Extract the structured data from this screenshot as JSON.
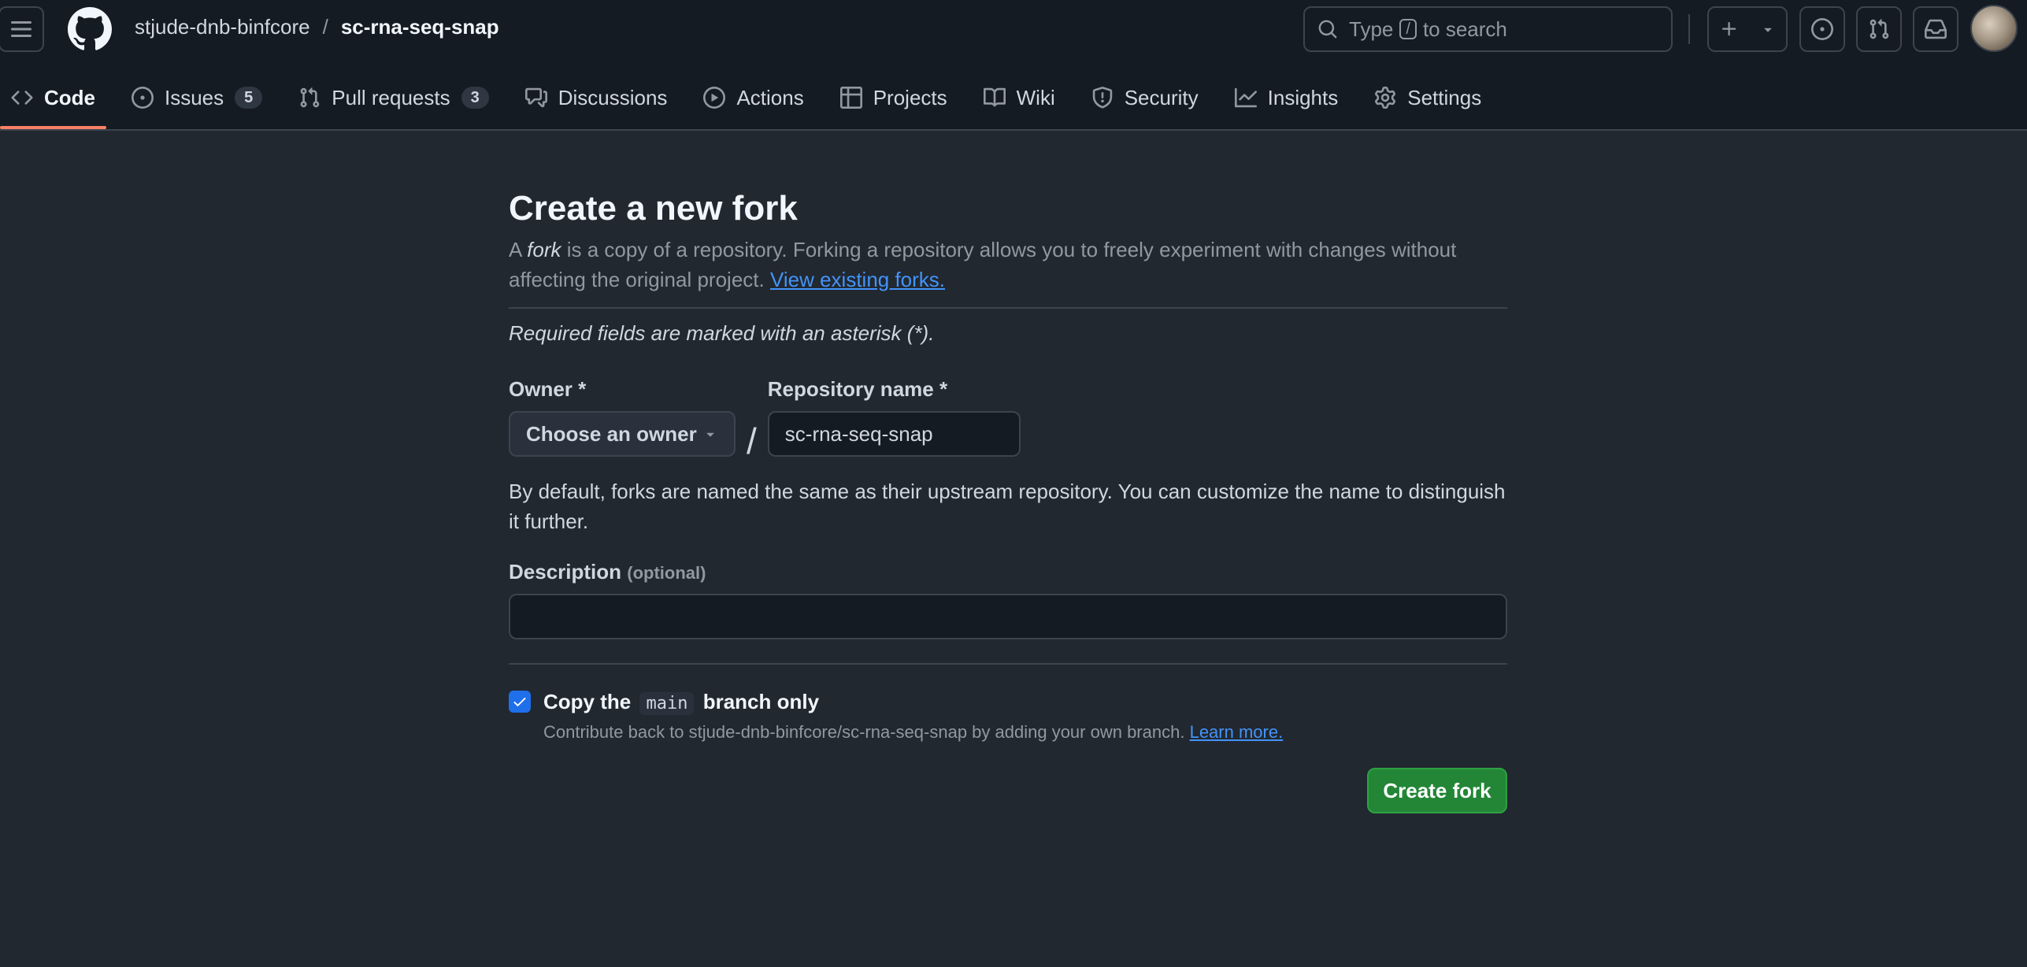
{
  "header": {
    "owner": "stjude-dnb-binfcore",
    "separator": "/",
    "repo": "sc-rna-seq-snap",
    "search": {
      "prefix": "Type",
      "key": "/",
      "suffix": "to search"
    }
  },
  "tabs": [
    {
      "label": "Code",
      "icon": "code-icon",
      "active": true
    },
    {
      "label": "Issues",
      "icon": "issue-opened-icon",
      "count": "5"
    },
    {
      "label": "Pull requests",
      "icon": "git-pull-request-icon",
      "count": "3"
    },
    {
      "label": "Discussions",
      "icon": "comment-discussion-icon"
    },
    {
      "label": "Actions",
      "icon": "play-icon"
    },
    {
      "label": "Projects",
      "icon": "table-icon"
    },
    {
      "label": "Wiki",
      "icon": "book-icon"
    },
    {
      "label": "Security",
      "icon": "shield-icon"
    },
    {
      "label": "Insights",
      "icon": "graph-icon"
    },
    {
      "label": "Settings",
      "icon": "gear-icon"
    }
  ],
  "form": {
    "title": "Create a new fork",
    "lead_a": "A",
    "lead_fork": "fork",
    "lead_b": "is a copy of a repository. Forking a repository allows you to freely experiment with changes without affecting the original project.",
    "view_forks": "View existing forks.",
    "required_note": "Required fields are marked with an asterisk (*).",
    "owner_label": "Owner *",
    "owner_value": "Choose an owner",
    "slash": "/",
    "repo_label": "Repository name *",
    "repo_value": "sc-rna-seq-snap",
    "name_hint": "By default, forks are named the same as their upstream repository. You can customize the name to distinguish it further.",
    "desc_label": "Description",
    "desc_optional": "(optional)",
    "desc_value": "",
    "copy_checked": true,
    "copy_a": "Copy the",
    "copy_branch": "main",
    "copy_b": "branch only",
    "copy_sub": "Contribute back to stjude-dnb-binfcore/sc-rna-seq-snap by adding your own branch.",
    "learn_more": "Learn more.",
    "submit": "Create fork"
  },
  "colors": {
    "page_bg": "#212830",
    "header_bg": "#151b23",
    "accent_underline": "#f78166",
    "link": "#4493f8",
    "primary_button": "#238636",
    "checkbox": "#1f6feb"
  }
}
